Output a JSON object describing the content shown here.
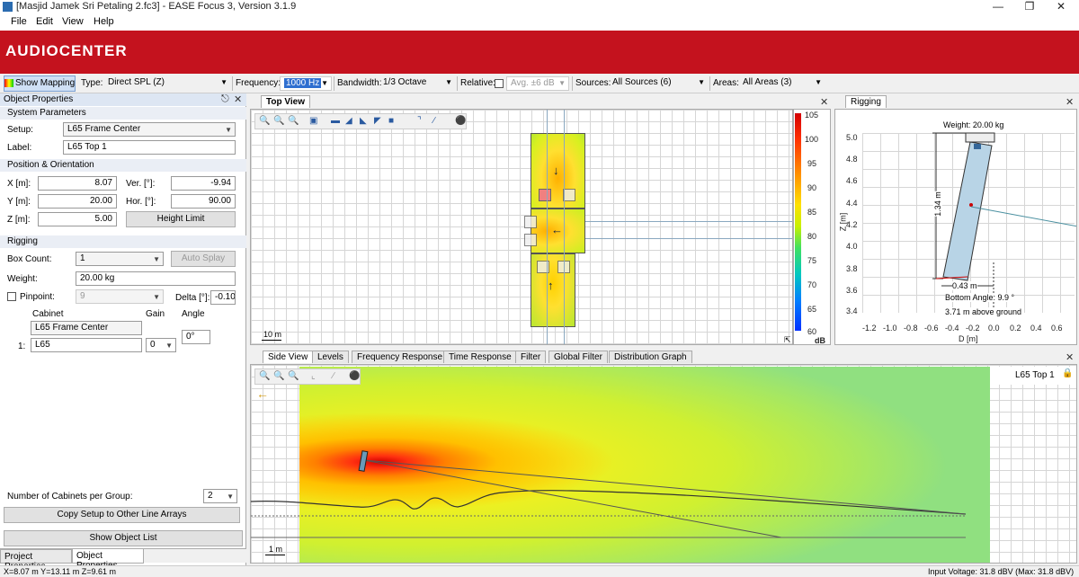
{
  "titlebar": {
    "title": "[Masjid Jamek Sri Petaling 2.fc3] - EASE Focus 3, Version 3.1.9"
  },
  "menu": [
    "File",
    "Edit",
    "View",
    "Help"
  ],
  "brand": {
    "logo": "AUDIOCENTER",
    "color": "#c4121e"
  },
  "toolbar": {
    "show_mapping": "Show Mapping",
    "type_label": "Type:",
    "type_value": "Direct SPL (Z)",
    "frequency_label": "Frequency:",
    "frequency_value": "1000 Hz",
    "bandwidth_label": "Bandwidth:",
    "bandwidth_value": "1/3 Octave",
    "relative_label": "Relative:",
    "relative_value": "Avg. ±6 dB",
    "sources_label": "Sources:",
    "sources_value": "All Sources (6)",
    "areas_label": "Areas:",
    "areas_value": "All Areas (3)"
  },
  "object_properties": {
    "title": "Object Properties",
    "system_parameters": "System Parameters",
    "setup_label": "Setup:",
    "setup_value": "L65 Frame Center",
    "label_label": "Label:",
    "label_value": "L65 Top 1",
    "position_orientation": "Position & Orientation",
    "x_label": "X [m]:",
    "x_value": "8.07",
    "y_label": "Y [m]:",
    "y_value": "20.00",
    "z_label": "Z [m]:",
    "z_value": "5.00",
    "ver_label": "Ver. [°]:",
    "ver_value": "-9.94",
    "hor_label": "Hor. [°]:",
    "hor_value": "90.00",
    "height_limit": "Height Limit",
    "rigging": "Rigging",
    "box_count_label": "Box Count:",
    "box_count_value": "1",
    "auto_splay": "Auto Splay",
    "weight_label": "Weight:",
    "weight_value": "20.00 kg",
    "pinpoint_label": "Pinpoint:",
    "pinpoint_value": "9",
    "delta_label": "Delta [°]:",
    "delta_value": "-0.10",
    "cabinet_header": "Cabinet",
    "gain_header": "Gain",
    "angle_header": "Angle",
    "cabinet_group": "L65 Frame Center",
    "row_index": "1:",
    "cabinet_value": "L65",
    "gain_value": "0",
    "angle_value": "0°",
    "num_cabinets_label": "Number of Cabinets per Group:",
    "num_cabinets_value": "2",
    "copy_setup": "Copy Setup to Other Line Arrays",
    "show_object_list": "Show Object List"
  },
  "left_tabs": [
    "Project Properties",
    "Object Properties"
  ],
  "top_view": {
    "tab": "Top View",
    "scale": "10 m",
    "colorbar_ticks": [
      "105",
      "100",
      "95",
      "90",
      "85",
      "80",
      "75",
      "70",
      "65",
      "60"
    ],
    "colorbar_unit": "dB"
  },
  "rigging": {
    "tab": "Rigging",
    "weight": "Weight: 20.00 kg",
    "dim_vertical": "1.34 m",
    "dim_horizontal": "0.43 m",
    "bottom_angle": "Bottom Angle: 9.9 °",
    "above_ground": "3.71 m above ground",
    "y_ticks": [
      "5.0",
      "4.8",
      "4.6",
      "4.4",
      "4.2",
      "4.0",
      "3.8",
      "3.6",
      "3.4"
    ],
    "x_ticks": [
      "-1.2",
      "-1.0",
      "-0.8",
      "-0.6",
      "-0.4",
      "-0.2",
      "0.0",
      "0.2",
      "0.4",
      "0.6"
    ],
    "ylabel": "Z [m]",
    "xlabel": "D [m]"
  },
  "bottom_tabs": [
    "Side View",
    "Levels",
    "Frequency Response",
    "Time Response",
    "Filter",
    "Global Filter",
    "Distribution Graph"
  ],
  "side_view": {
    "label": "L65 Top 1",
    "scale": "1 m"
  },
  "status": {
    "coords": "X=8.07 m Y=13.11 m Z=9.61 m",
    "input_voltage": "Input Voltage: 31.8 dBV (Max: 31.8 dBV)"
  }
}
